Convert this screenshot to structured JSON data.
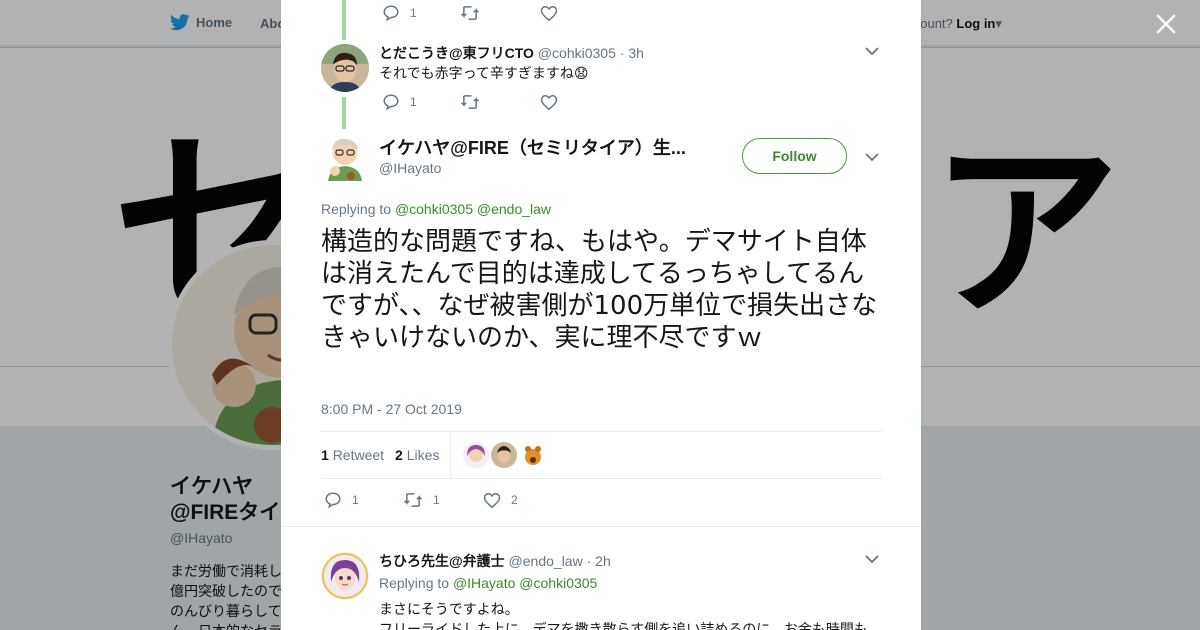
{
  "background": {
    "nav_home": "Home",
    "nav_about": "Abo",
    "account_prompt": "account?",
    "login_label": "Log in",
    "banner_char_left": "セ",
    "banner_char_right": "ア",
    "profile_name": "イケハヤ@FIREタイア）生",
    "profile_handle": "@IHayato",
    "profile_bio": "まだ労働で消耗し億円突破したのでのんびり暮らしてん。日本的なセラ"
  },
  "close_icon": "close-icon",
  "reply_prev": {
    "reply_count": "1"
  },
  "reply_1": {
    "name": "とだこうき@東フリCTO",
    "handle": "@cohki0305",
    "separator": "·",
    "time": "3h",
    "text": "それでも赤字って辛すぎますね😧",
    "reply_count": "1"
  },
  "main_tweet": {
    "name": "イケハヤ@FIRE（セミリタイア）生...",
    "handle": "@IHayato",
    "follow_label": "Follow",
    "replying_label": "Replying to",
    "replying_to": [
      "@cohki0305",
      "@endo_law"
    ],
    "text": "構造的な問題ですね、もはや。デマサイト自体は消えたんで目的は達成してるっちゃしてるんですが、、なぜ被害側が100万単位で損失出さなきゃいけないのか、実に理不尽ですｗ",
    "timestamp": "8:00 PM - 27 Oct 2019",
    "retweet_count": "1",
    "retweet_label": "Retweet",
    "like_count": "2",
    "like_label": "Likes",
    "action_reply_count": "1",
    "action_retweet_count": "1",
    "action_like_count": "2"
  },
  "reply_2": {
    "name": "ちひろ先生@弁護士",
    "handle": "@endo_law",
    "separator": "·",
    "time": "2h",
    "replying_label": "Replying to",
    "replying_to": [
      "@IHayato",
      "@cohki0305"
    ],
    "text_line1": "まさにそうですよね。",
    "text_line2": "フリーライドした上に、デマを撒き散らす側を追い詰めるのに、お金も時間も"
  },
  "colors": {
    "accent_green": "#3b8a2e",
    "thread_line": "#a5d6a7",
    "twitter_blue": "#1da1f2",
    "muted": "#657786"
  }
}
